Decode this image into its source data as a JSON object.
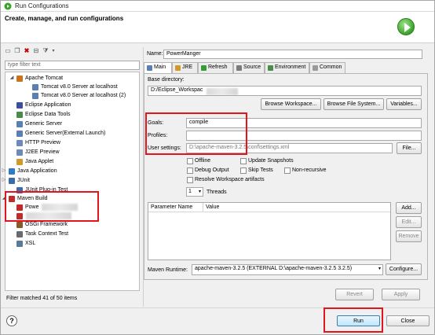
{
  "window": {
    "title": "Run Configurations"
  },
  "header": {
    "title": "Create, manage, and run configurations"
  },
  "filter": {
    "placeholder": "type filter text"
  },
  "tree": {
    "items": [
      {
        "label": "Apache Tomcat",
        "icon": "tomcat-icon",
        "color": "#c9741c"
      },
      {
        "label": "Tomcat v8.0 Server at localhost",
        "icon": "server-icon",
        "color": "#5a7fb5"
      },
      {
        "label": "Tomcat v8.0 Server at localhost (2)",
        "icon": "server-icon",
        "color": "#5a7fb5"
      },
      {
        "label": "Eclipse Application",
        "icon": "eclipse-icon",
        "color": "#3b4fa0"
      },
      {
        "label": "Eclipse Data Tools",
        "icon": "database-icon",
        "color": "#4a8a4a"
      },
      {
        "label": "Generic Server",
        "icon": "server-icon",
        "color": "#5a7fb5"
      },
      {
        "label": "Generic Server(External Launch)",
        "icon": "server-icon",
        "color": "#5a7fb5"
      },
      {
        "label": "HTTP Preview",
        "icon": "web-icon",
        "color": "#6c8ab8"
      },
      {
        "label": "J2EE Preview",
        "icon": "web-icon",
        "color": "#6c8ab8"
      },
      {
        "label": "Java Applet",
        "icon": "applet-icon",
        "color": "#d09a2a"
      },
      {
        "label": "Java Application",
        "icon": "java-icon",
        "color": "#2e7dc4"
      },
      {
        "label": "JUnit",
        "icon": "junit-icon",
        "color": "#3a6ea8"
      },
      {
        "label": "JUnit Plug-in Test",
        "icon": "junit-icon",
        "color": "#3a6ea8"
      },
      {
        "label": "Maven Build",
        "icon": "maven-icon",
        "color": "#c42828"
      },
      {
        "label": "Powe",
        "icon": "maven-icon",
        "color": "#c42828"
      },
      {
        "label": "",
        "icon": "maven-icon",
        "color": "#c42828"
      },
      {
        "label": "OSGi Framework",
        "icon": "osgi-icon",
        "color": "#8a5a2a"
      },
      {
        "label": "Task Context Test",
        "icon": "task-icon",
        "color": "#6a6a6a"
      },
      {
        "label": "XSL",
        "icon": "xsl-icon",
        "color": "#5a7a9a"
      }
    ]
  },
  "status": {
    "filtered": "Filter matched 41 of 50 items"
  },
  "config": {
    "name_label": "Name:",
    "name_value": "PowerManger",
    "tabs": [
      "Main",
      "JRE",
      "Refresh",
      "Source",
      "Environment",
      "Common"
    ],
    "base_dir_label": "Base directory:",
    "base_dir_value": "D:/Eclipse_Workspac",
    "browse_workspace": "Browse Workspace...",
    "browse_fs": "Browse File System...",
    "variables": "Variables...",
    "goals_label": "Goals:",
    "goals_value": "compile",
    "profiles_label": "Profiles:",
    "profiles_value": "",
    "user_settings_label": "User settings:",
    "user_settings_value": "D:\\apache-maven-3.2.5\\conf\\settings.xml",
    "file_button": "File...",
    "checks": [
      {
        "label": "Offline",
        "checked": false
      },
      {
        "label": "Update Snapshots",
        "checked": false
      },
      {
        "label": "Debug Output",
        "checked": false
      },
      {
        "label": "Skip Tests",
        "checked": false
      },
      {
        "label": "Non-recursive",
        "checked": false
      },
      {
        "label": "Resolve Workspace artifacts",
        "checked": false
      }
    ],
    "threads_value": "1",
    "threads_label": "Threads",
    "param_headers": [
      "Parameter Name",
      "Value"
    ],
    "add": "Add...",
    "edit": "Edit...",
    "remove": "Remove",
    "runtime_label": "Maven Runtime:",
    "runtime_value": "apache-maven-3.2.5 (EXTERNAL D:\\apache-maven-3.2.5 3.2.5)",
    "configure": "Configure...",
    "revert": "Revert",
    "apply": "Apply"
  },
  "footer": {
    "run": "Run",
    "close": "Close",
    "help": "?"
  },
  "colors": {
    "highlight": "#e3141b",
    "accent": "#3aa32a"
  }
}
